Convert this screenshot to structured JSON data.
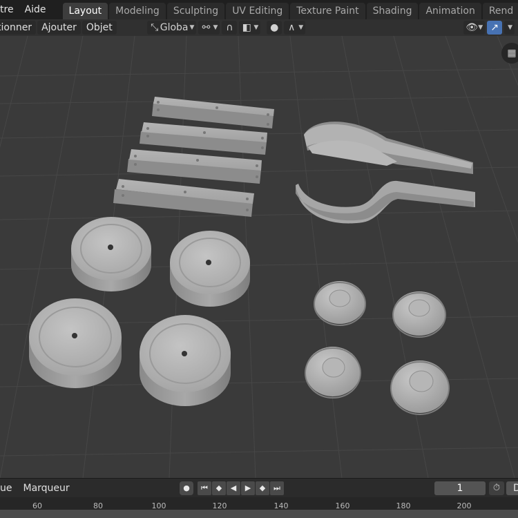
{
  "menubar": {
    "items": [
      {
        "name": "menu-fenetre",
        "label": "tre"
      },
      {
        "name": "menu-aide",
        "label": "Aide"
      }
    ]
  },
  "workspaces": {
    "tabs": [
      {
        "label": "Layout",
        "active": true
      },
      {
        "label": "Modeling"
      },
      {
        "label": "Sculpting"
      },
      {
        "label": "UV Editing"
      },
      {
        "label": "Texture Paint"
      },
      {
        "label": "Shading"
      },
      {
        "label": "Animation"
      },
      {
        "label": "Rend"
      }
    ]
  },
  "viewport_header": {
    "menus": [
      {
        "name": "menu-selectionner",
        "label": "tionner"
      },
      {
        "name": "menu-ajouter",
        "label": "Ajouter"
      },
      {
        "name": "menu-objet",
        "label": "Objet"
      }
    ],
    "orientation_label": "Globa",
    "icons": {
      "transform": "transform-orientation-icon",
      "pivot": "pivot-point-icon",
      "snap": "snap-icon",
      "snap_target": "snap-target-icon",
      "proportional": "proportional-editing-icon",
      "falloff": "falloff-curve-icon",
      "visibility": "visibility-eye-icon",
      "gizmo": "gizmo-toggle-icon",
      "grid": "grid-view-icon"
    }
  },
  "timeline": {
    "menus": [
      {
        "name": "menu-vue",
        "label": "ue"
      },
      {
        "name": "menu-marqueur",
        "label": "Marqueur"
      }
    ],
    "current_frame": "1",
    "end_field": "D",
    "ruler_labels": [
      "60",
      "80",
      "100",
      "120",
      "140",
      "160",
      "180",
      "200"
    ]
  },
  "colors": {
    "accent_blue": "#4772b3",
    "viewport_bg": "#3a3a3a",
    "object_gray": "#a8a8a8"
  }
}
